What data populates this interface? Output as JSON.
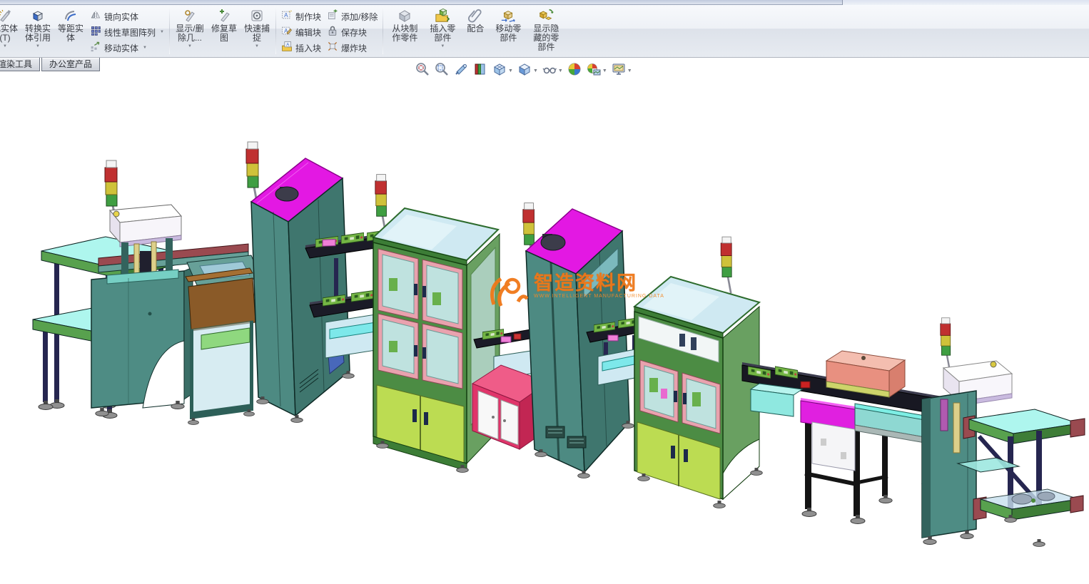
{
  "ribbon": {
    "buttons": {
      "trim": "裁实体(T)",
      "convert": "转换实体引用",
      "offset": "等距实体",
      "mirror": "镜向实体",
      "linear_pattern": "线性草图阵列",
      "move_entities": "移动实体",
      "display_delete": "显示/删除几...",
      "repair_sketch": "修复草图",
      "quick_snaps": "快速捕捉",
      "make_block": "制作块",
      "edit_block": "编辑块",
      "insert_block": "插入块",
      "add_remove": "添加/移除",
      "save_block": "保存块",
      "explode_block": "爆炸块",
      "make_part_from_block": "从块制作零件",
      "insert_components": "插入零部件",
      "mate": "配合",
      "move_component": "移动零部件",
      "show_hidden": "显示隐藏的零部件"
    }
  },
  "tabs": [
    {
      "label": "渲染工具"
    },
    {
      "label": "办公室产品"
    }
  ],
  "viewbar": {
    "icons": [
      "zoom-to-fit",
      "zoom-to-area",
      "previous-view",
      "section-view",
      "view-orientation",
      "display-style",
      "hide-show-items",
      "edit-appearance",
      "apply-scene",
      "view-settings"
    ]
  },
  "watermark": {
    "title": "智造资料网",
    "subtitle": "WWW.INTELLIGENT MANUFACTURING DATA",
    "color": "#F07818"
  },
  "scene": {
    "description": "3D assembly model of an automated PCB production line with load/unload stair conveyors, press stations, tall tower cabinets, glass-door inspection machines and link conveyors",
    "stations": [
      "left-unload-stair-conveyor",
      "press-station-left",
      "brown-buffer-enclosure",
      "tower-cabinet-1",
      "link-conveyor-1",
      "inspection-machine-1",
      "crimson-feeder",
      "tower-cabinet-2",
      "link-conveyor-2",
      "inspection-machine-2",
      "transfer-table-conveyor",
      "right-unload-stair-conveyor"
    ],
    "palette": {
      "machine_teal": "#4D8A82",
      "machine_teal_dark": "#3F766E",
      "magenta_top": "#E318E3",
      "frame_green": "#3C7D36",
      "door_lime": "#BCDC52",
      "door_pink": "#E9A2AE",
      "glass_blue": "#CFE9F2",
      "conveyor_cyan": "#AEF6EE",
      "rail_green": "#58A14E",
      "post_navy": "#262650",
      "end_cap_maroon": "#9A4A50",
      "buffer_brown": "#8A5A28",
      "crimson_box": "#E0356A",
      "salmon_box": "#E89080",
      "magenta_panel": "#E020E0",
      "pcb_green": "#74B544",
      "tower_red": "#C03030",
      "tower_yellow": "#CFC23A",
      "tower_green": "#3F9E42"
    }
  }
}
